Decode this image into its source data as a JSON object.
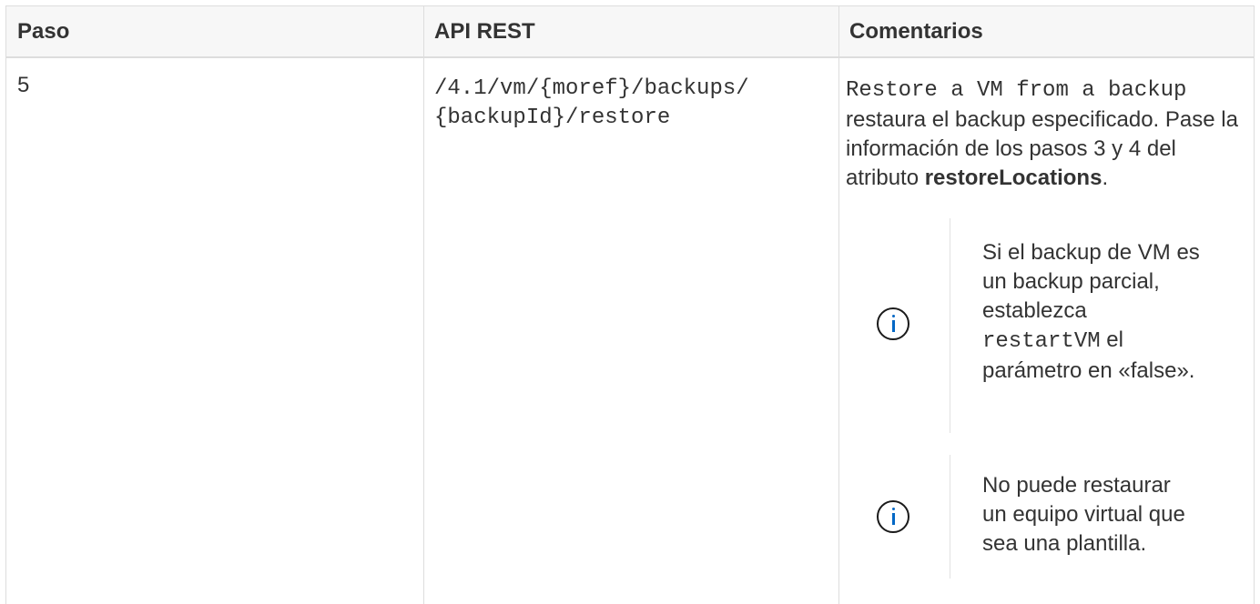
{
  "headers": {
    "step": "Paso",
    "api": "API REST",
    "comments": "Comentarios"
  },
  "row": {
    "step": "5",
    "api_line1": "/4.1/vm/{moref}/backups/",
    "api_line2": "{backupId}/restore",
    "comment_code": "Restore a VM from a backup",
    "comment_text_1": "restaura el backup especificado. Pase la información de los pasos 3 y 4 del atributo ",
    "comment_bold": "restoreLocations",
    "comment_text_2": "."
  },
  "notes": [
    {
      "icon": "info-icon",
      "text_before": "Si el backup de VM es un backup parcial, establezca ",
      "code": "restartVM",
      "text_after": " el parámetro en «false»."
    },
    {
      "icon": "info-icon",
      "text_before": "No puede restaurar un equipo virtual que sea una plantilla.",
      "code": "",
      "text_after": ""
    }
  ],
  "colors": {
    "border": "#dddddd",
    "header_bg": "#f7f7f7",
    "text": "#333333",
    "icon_accent": "#0067c5"
  }
}
